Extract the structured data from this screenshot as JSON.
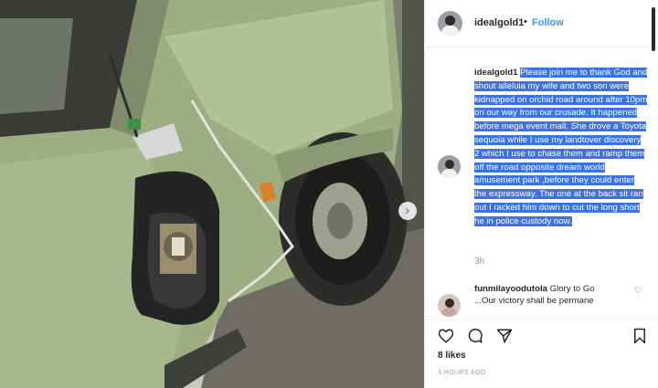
{
  "post": {
    "username": "idealgold1",
    "follow_label": "Follow",
    "separator": "•",
    "caption": "Please join me to thank God and shout alleluia my wife and two son were kidnapped on orchid road around after 10pm on our way from our crusade. It happened before mega event mall. She drove a Toyota sequoia while I use my landtover discovery 2 which I use to chase them and ramp them off the road opposite dream world amusement park ,before they could enter the expressway. The one at the back sit ran out I racked him down to cut the long short he in police custody now.",
    "time_ago": "3h",
    "likes": "8 likes",
    "posted_at": "3 HOURS AGO"
  },
  "comment": {
    "username": "funmilayoodutola",
    "text_line1": "Glory to Go",
    "text_line2": "...Our victory shall be permane"
  },
  "icons": {
    "next": "chevron-right-icon",
    "like": "heart-icon",
    "comment": "comment-icon",
    "share": "share-icon",
    "save": "bookmark-icon",
    "comment_like": "heart-small-icon"
  },
  "colors": {
    "follow": "#3897f0",
    "highlight": "#3b73e6",
    "car_body": "#9eae82"
  }
}
